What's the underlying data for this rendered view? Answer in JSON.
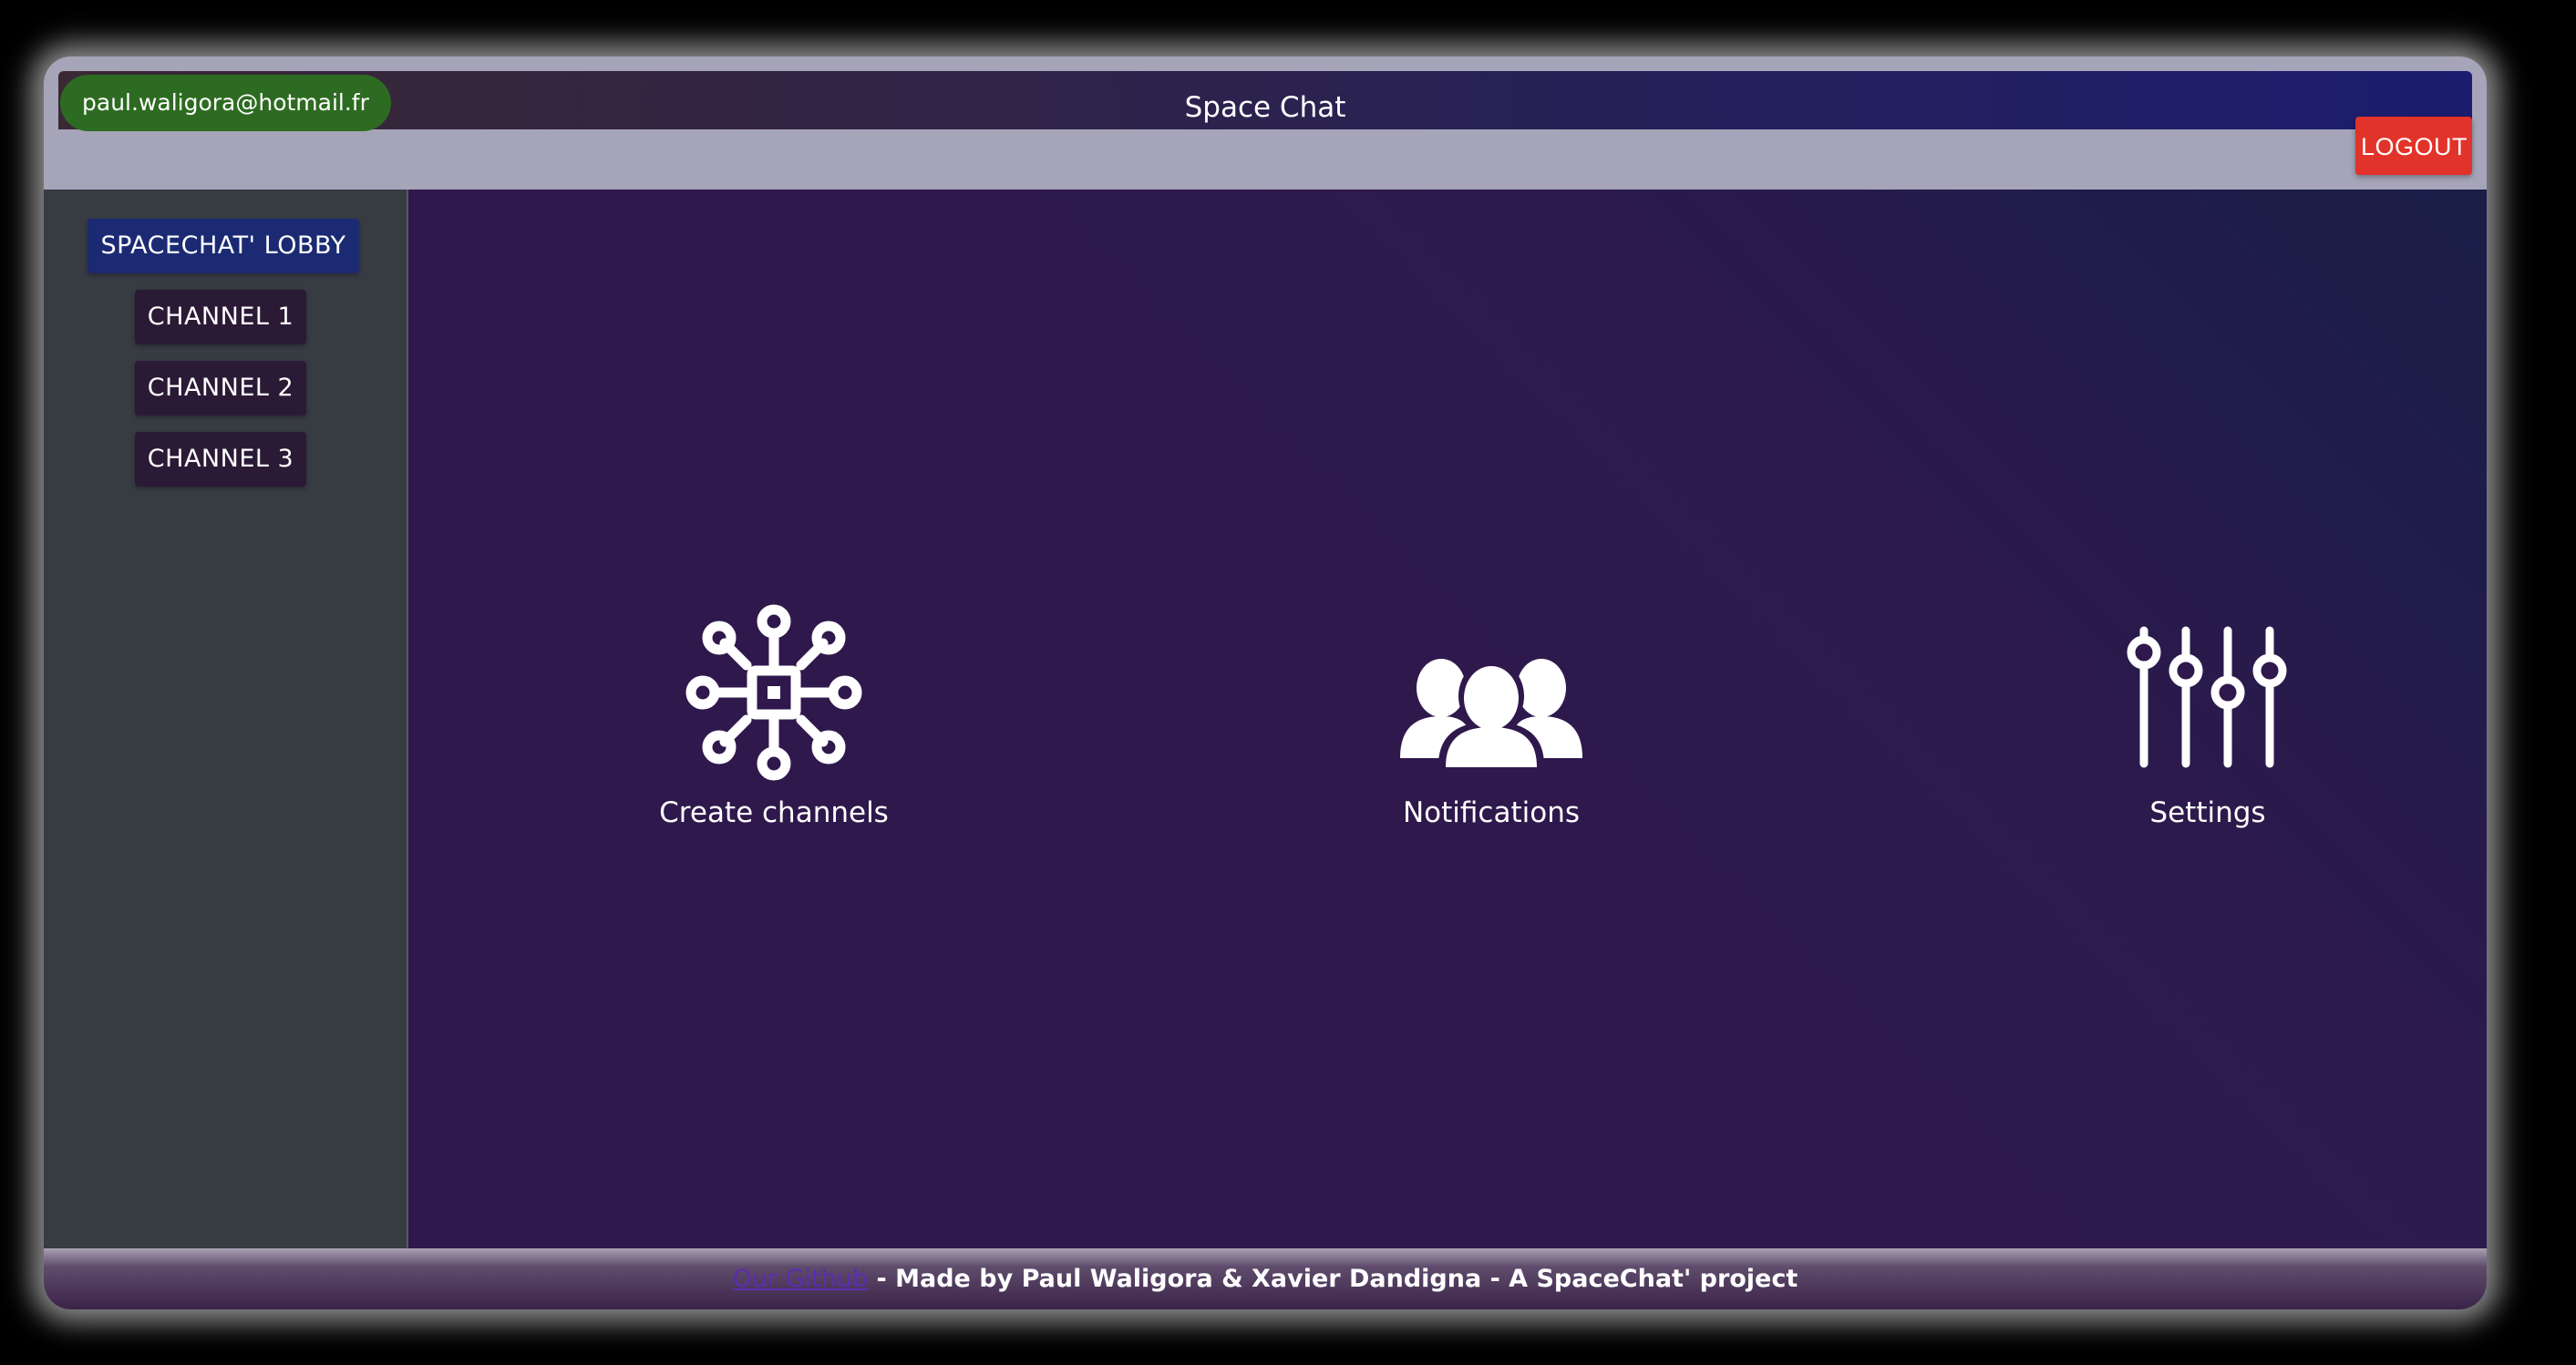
{
  "header": {
    "user_email": "paul.waligora@hotmail.fr",
    "title": "Space Chat",
    "logout_label": "LOGOUT"
  },
  "sidebar": {
    "items": [
      {
        "label": "SPACECHAT' LOBBY"
      },
      {
        "label": "CHANNEL 1"
      },
      {
        "label": "CHANNEL 2"
      },
      {
        "label": "CHANNEL 3"
      }
    ]
  },
  "main": {
    "features": [
      {
        "label": "Create channels",
        "icon": "network-hub-icon"
      },
      {
        "label": "Notifications",
        "icon": "users-group-icon"
      },
      {
        "label": "Settings",
        "icon": "sliders-icon"
      }
    ]
  },
  "footer": {
    "link_label": "Our Github",
    "text": " - Made by Paul Waligora & Xavier Dandigna - A SpaceChat' project"
  },
  "colors": {
    "email_pill": "#2e6b22",
    "logout": "#e2332a",
    "lobby_button": "#1b2a73",
    "channel_button": "#2a1a36",
    "main_background": "#2f184c",
    "sidebar_background": "#373b42"
  }
}
